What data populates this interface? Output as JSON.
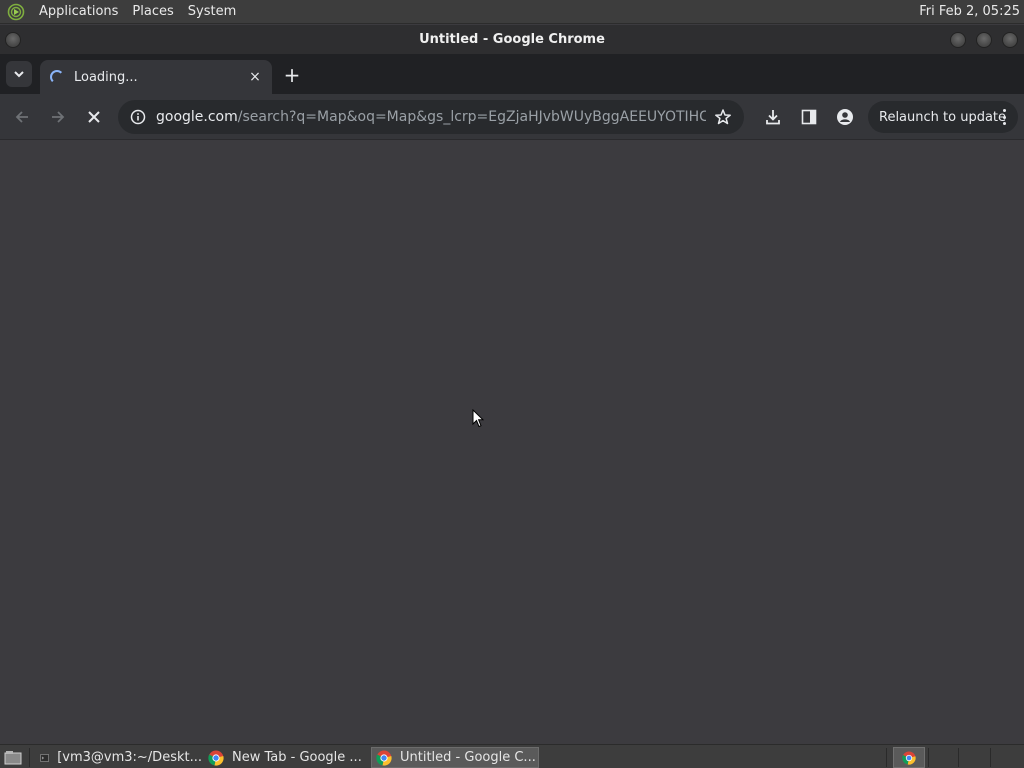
{
  "top_panel": {
    "menus": [
      "Applications",
      "Places",
      "System"
    ],
    "clock": "Fri Feb  2, 05:25"
  },
  "window": {
    "title": "Untitled - Google Chrome"
  },
  "tabs": [
    {
      "label": "Loading...",
      "close": "×"
    }
  ],
  "new_tab_label": "+",
  "toolbar": {
    "url_host": "google.com",
    "url_rest": "/search?q=Map&oq=Map&gs_lcrp=EgZjaHJvbWUyBggAEEUYOTIHCAEQA...",
    "relaunch_label": "Relaunch to update"
  },
  "taskbar": {
    "items": [
      {
        "label": "[vm3@vm3:~/Deskt..."
      },
      {
        "label": "New Tab - Google ..."
      },
      {
        "label": "Untitled - Google C..."
      }
    ]
  },
  "colors": {
    "accent": "#8ab4f8",
    "page_bg": "#3c3b3f",
    "toolbar_bg": "#35363a",
    "tabstrip_bg": "#202124"
  },
  "icons": [
    "applications-logo-icon",
    "tab-search-icon",
    "loading-spinner-icon",
    "close-icon",
    "plus-icon",
    "back-arrow-icon",
    "forward-arrow-icon",
    "stop-icon",
    "info-icon",
    "star-icon",
    "download-icon",
    "side-panel-icon",
    "profile-icon",
    "more-vert-icon",
    "show-desktop-icon",
    "terminal-icon",
    "chrome-icon",
    "mouse-cursor-icon"
  ]
}
